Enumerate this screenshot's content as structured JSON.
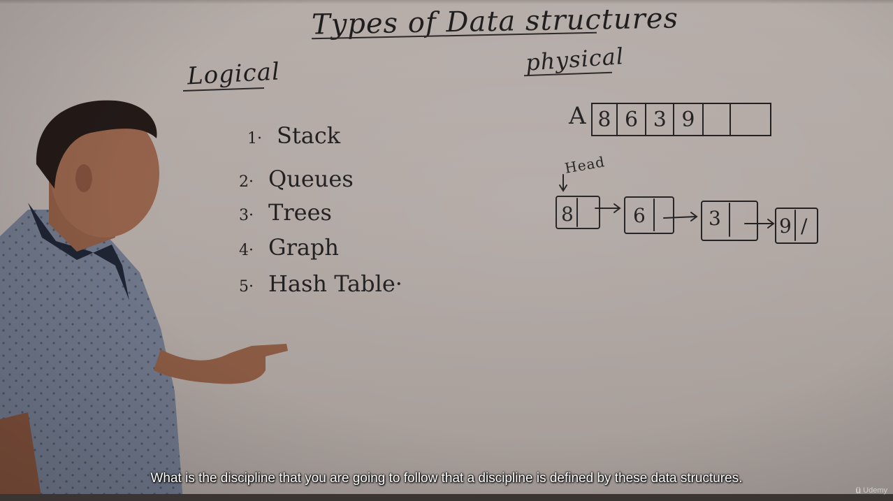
{
  "board": {
    "title": "Types of Data structures",
    "logical_heading": "Logical",
    "physical_heading": "physical",
    "logical_list": [
      {
        "num": "1·",
        "label": "Stack"
      },
      {
        "num": "2·",
        "label": "Queues"
      },
      {
        "num": "3·",
        "label": "Trees"
      },
      {
        "num": "4·",
        "label": "Graph"
      },
      {
        "num": "5·",
        "label": "Hash Table·"
      }
    ],
    "array": {
      "label": "A",
      "cells": [
        "8",
        "6",
        "3",
        "9",
        "",
        ""
      ]
    },
    "linked_list": {
      "head_label": "Head",
      "nodes": [
        "8",
        "6",
        "3",
        "9"
      ],
      "terminator": "/"
    }
  },
  "subtitle": "What is the discipline that you are going to follow that a discipline is defined by these data structures.",
  "watermark": {
    "logo": "ü",
    "text": "Udemy"
  },
  "colors": {
    "board": "#b1a8a4",
    "marker": "#1e1b1c",
    "shirt": "#6e7689",
    "subtitle": "#ffffff"
  }
}
